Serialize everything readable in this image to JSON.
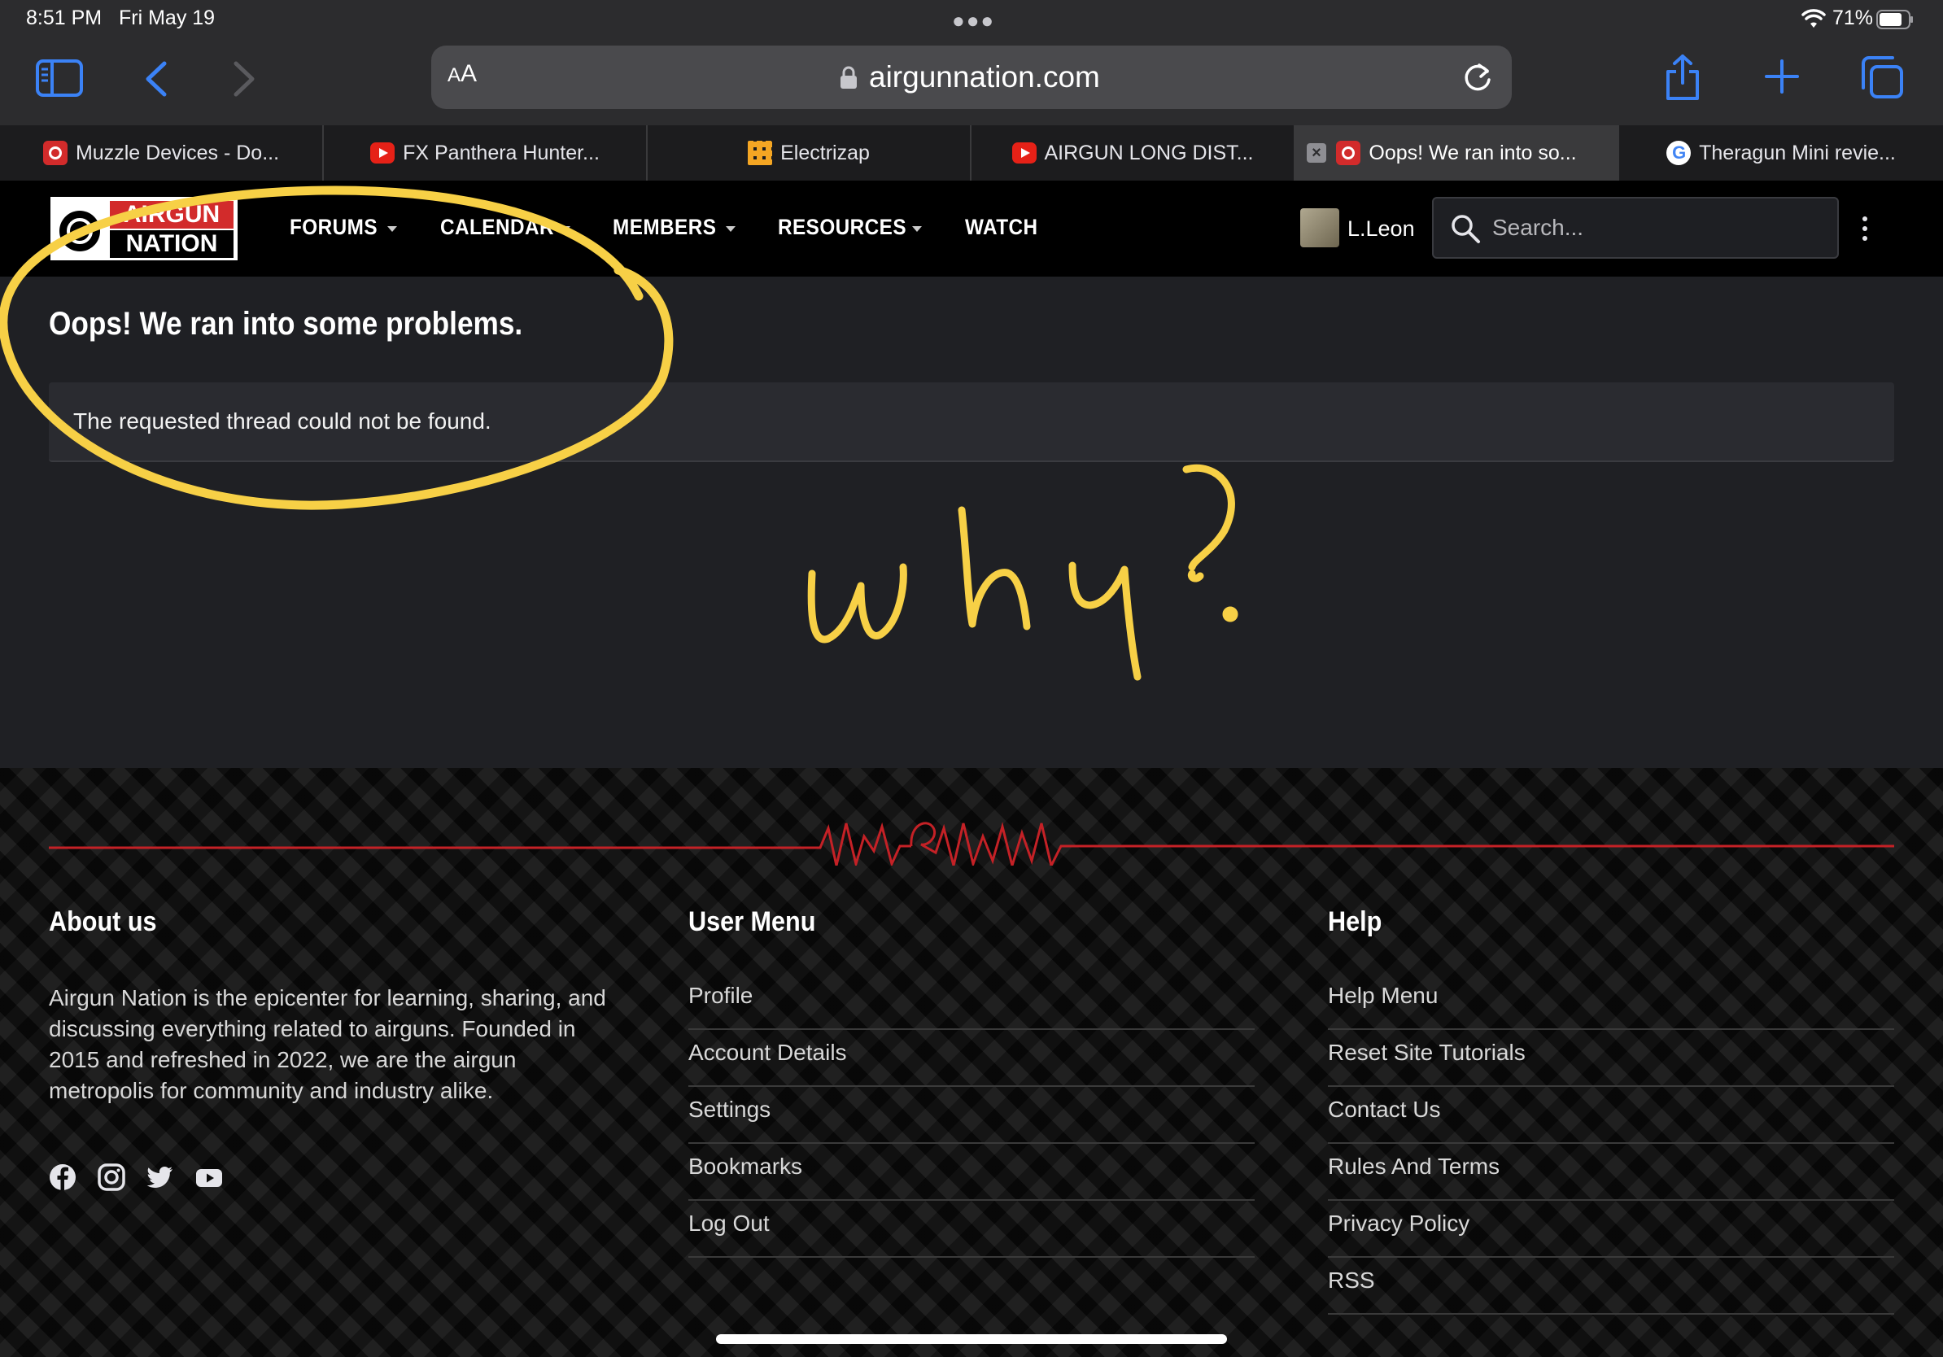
{
  "status_bar": {
    "time": "8:51 PM",
    "date": "Fri May 19",
    "battery": "71%"
  },
  "browser": {
    "reader_label_small": "A",
    "reader_label_large": "A",
    "url": "airgunnation.com",
    "tabs": [
      {
        "title": "Muzzle Devices - Do...",
        "favicon": "airgun-nation-favicon"
      },
      {
        "title": "FX Panthera Hunter...",
        "favicon": "youtube-favicon"
      },
      {
        "title": "Electrizap",
        "favicon": "electrizap-favicon"
      },
      {
        "title": "AIRGUN LONG DIST...",
        "favicon": "youtube-favicon"
      },
      {
        "title": "Oops! We ran into so...",
        "favicon": "airgun-nation-favicon",
        "active": true
      },
      {
        "title": "Theragun Mini revie...",
        "favicon": "google-favicon"
      }
    ]
  },
  "site": {
    "logo_top": "AIRGUN",
    "logo_bottom": "NATION",
    "nav": {
      "forums": "FORUMS",
      "calendar": "CALENDAR",
      "members": "MEMBERS",
      "resources": "RESOURCES",
      "watch": "WATCH"
    },
    "user": "L.Leon",
    "search_placeholder": "Search..."
  },
  "error": {
    "title": "Oops! We ran into some problems.",
    "message": "The requested thread could not be found."
  },
  "annotation": {
    "text": "why?",
    "color": "#f7d046"
  },
  "footer": {
    "about_heading": "About us",
    "about_text": "Airgun Nation is the epicenter for learning, sharing, and discussing everything related to airguns. Founded in 2015 and refreshed in 2022, we are the airgun metropolis for community and industry alike.",
    "social": [
      "facebook-icon",
      "instagram-icon",
      "twitter-icon",
      "youtube-icon"
    ],
    "user_menu_heading": "User Menu",
    "user_menu": [
      "Profile",
      "Account Details",
      "Settings",
      "Bookmarks",
      "Log Out"
    ],
    "help_heading": "Help",
    "help_menu": [
      "Help Menu",
      "Reset Site Tutorials",
      "Contact Us",
      "Rules And Terms",
      "Privacy Policy",
      "RSS"
    ]
  },
  "colors": {
    "accent_red": "#d22b2b",
    "ios_blue": "#3b82f6"
  }
}
